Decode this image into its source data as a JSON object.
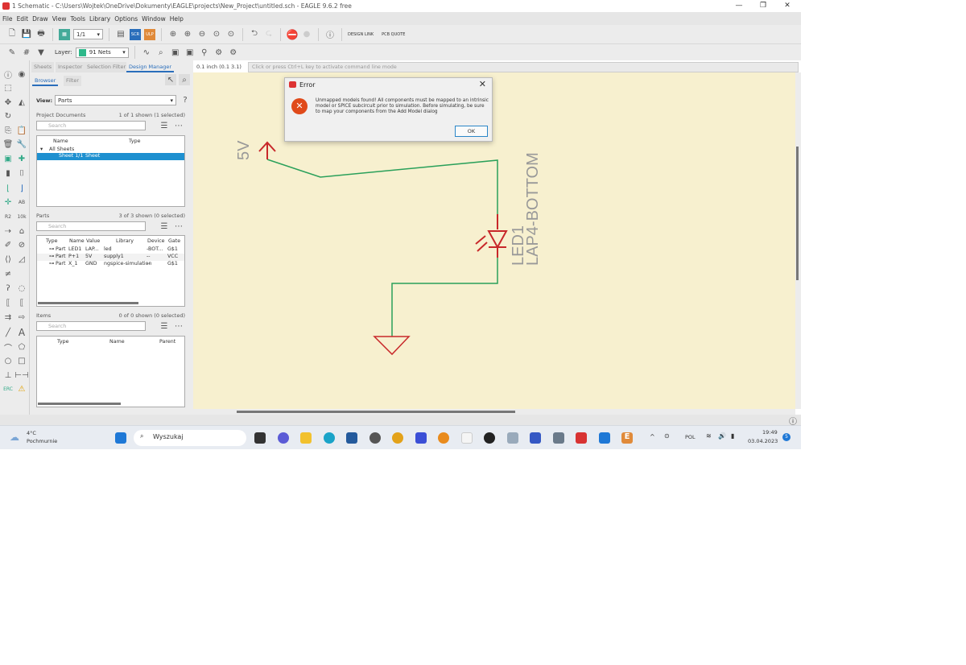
{
  "window": {
    "title": "1 Schematic - C:\\Users\\Wojtek\\OneDrive\\Dokumenty\\EAGLE\\projects\\New_Project\\untitled.sch - EAGLE 9.6.2 free",
    "minimize": "—",
    "maximize": "❐",
    "close": "✕"
  },
  "menu": [
    "File",
    "Edit",
    "Draw",
    "View",
    "Tools",
    "Library",
    "Options",
    "Window",
    "Help"
  ],
  "toolbar": {
    "sheet": "1/1",
    "design_link": "DESIGN LINK",
    "pcb_quote": "PCB QUOTE",
    "layer_label": "Layer:",
    "layer_value": "91 Nets",
    "layer_color": "#2eb88a"
  },
  "panel": {
    "tabs": [
      "Sheets",
      "Inspector",
      "Selection Filter",
      "Design Manager"
    ],
    "subtabs": [
      "Browser",
      "Filter"
    ],
    "view_label": "View:",
    "view_value": "Parts",
    "project_docs": {
      "title": "Project Documents",
      "count": "1 of 1 shown (1 selected)",
      "search": "Search",
      "columns": [
        "Name",
        "Type"
      ],
      "group": "All Sheets",
      "selected_row": {
        "name": "Sheet 1/1",
        "type": "Sheet"
      }
    },
    "parts": {
      "title": "Parts",
      "count": "3 of 3 shown (0 selected)",
      "search": "Search",
      "columns": [
        "Type",
        "Name",
        "Value",
        "Library",
        "Device",
        "Gate"
      ],
      "rows": [
        [
          "Part",
          "LED1",
          "LAP...",
          "led",
          "-BOT...",
          "G$1"
        ],
        [
          "Part",
          "P+1",
          "5V",
          "supply1",
          "--",
          "VCC"
        ],
        [
          "Part",
          "X_1",
          "GND",
          "ngspice-simulation",
          "--",
          "G$1"
        ]
      ]
    },
    "items": {
      "title": "Items",
      "count": "0 of 0 shown (0 selected)",
      "search": "Search",
      "columns": [
        "Type",
        "Name",
        "Parent"
      ]
    }
  },
  "coord": "0.1 inch (0.1 3.1)",
  "command_placeholder": "Click or press Ctrl+L key to activate command line mode",
  "schematic": {
    "supply_label": "5V",
    "led_name": "LED1",
    "led_value": "LAP4-BOTTOM",
    "wire_color": "#2aa05a",
    "symbol_color": "#c8282a",
    "text_color": "#999999",
    "background": "#f7f0cf"
  },
  "dialog": {
    "title": "Error",
    "message": "Unmapped models found! All components must be mapped to an intrinsic model or SPICE subcircuit prior to simulation.  Before simulating, be sure to map your components from the Add Model dialog",
    "ok": "OK"
  },
  "taskbar": {
    "temp": "4°C",
    "weather": "Pochmurnie",
    "search": "Wyszukaj",
    "lang": "POL",
    "time": "19:49",
    "date": "03.04.2023",
    "notif": "5"
  }
}
